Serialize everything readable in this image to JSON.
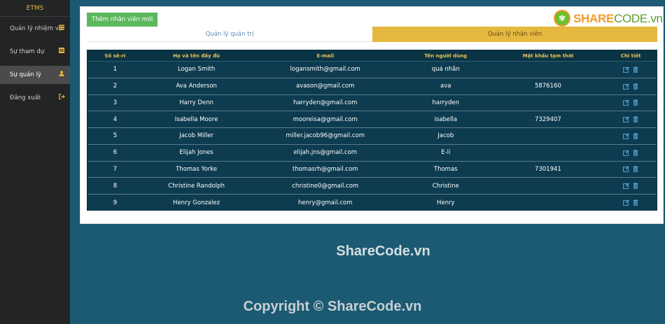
{
  "sidebar": {
    "brand": "ETMS",
    "items": [
      {
        "label": "Quản lý nhiệm vụ",
        "icon": "tasks-icon"
      },
      {
        "label": "Sự tham dự",
        "icon": "calendar-icon"
      },
      {
        "label": "Sự quản lý",
        "icon": "user-icon",
        "active": true
      },
      {
        "label": "Đăng xuất",
        "icon": "logout-icon"
      }
    ]
  },
  "main": {
    "add_button": "Thêm nhân viên mới",
    "tabs": [
      {
        "label": "Quản lý quản trị"
      },
      {
        "label": "Quản lý nhân viên",
        "active": true
      }
    ],
    "logo": {
      "strong": "SHARE",
      "light": "CODE.vn"
    }
  },
  "table": {
    "headers": [
      "Số sê-ri",
      "Họ và tên đầy đủ",
      "E-mail",
      "Tên người dùng",
      "Mật khẩu tạm thời",
      "Chi tiết"
    ],
    "rows": [
      {
        "no": "1",
        "name": "Logan Smith",
        "email": "logansmith@gmail.com",
        "username": "quả nhãn",
        "temp_password": ""
      },
      {
        "no": "2",
        "name": "Ava Anderson",
        "email": "avason@gmail.com",
        "username": "ava",
        "temp_password": "5876160"
      },
      {
        "no": "3",
        "name": "Harry Denn",
        "email": "harryden@gmail.com",
        "username": "harryden",
        "temp_password": ""
      },
      {
        "no": "4",
        "name": "Isabella Moore",
        "email": "mooreisa@gmail.com",
        "username": "isabella",
        "temp_password": "7329407"
      },
      {
        "no": "5",
        "name": "Jacob Miller",
        "email": "miller.jacob96@gmail.com",
        "username": "Jacob",
        "temp_password": ""
      },
      {
        "no": "6",
        "name": "Elijah Jones",
        "email": "elijah.jns@gmail.com",
        "username": "Ê-li",
        "temp_password": ""
      },
      {
        "no": "7",
        "name": "Thomas Yorke",
        "email": "thomasrh@gmail.com",
        "username": "Thomas",
        "temp_password": "7301941"
      },
      {
        "no": "8",
        "name": "Christine Randolph",
        "email": "christine0@gmail.com",
        "username": "Christine",
        "temp_password": ""
      },
      {
        "no": "9",
        "name": "Henry Gonzalez",
        "email": "henry@gmail.com",
        "username": "Henry",
        "temp_password": ""
      }
    ]
  },
  "watermark": {
    "center": "ShareCode.vn",
    "copyright": "Copyright © ShareCode.vn"
  },
  "colors": {
    "sidebar_bg": "#222425",
    "accent": "#e4b53c",
    "table_bg": "#0d3b4f",
    "page_bg": "#1b5a72",
    "add_button": "#5cb85c",
    "active_tab": "#e5b840"
  }
}
